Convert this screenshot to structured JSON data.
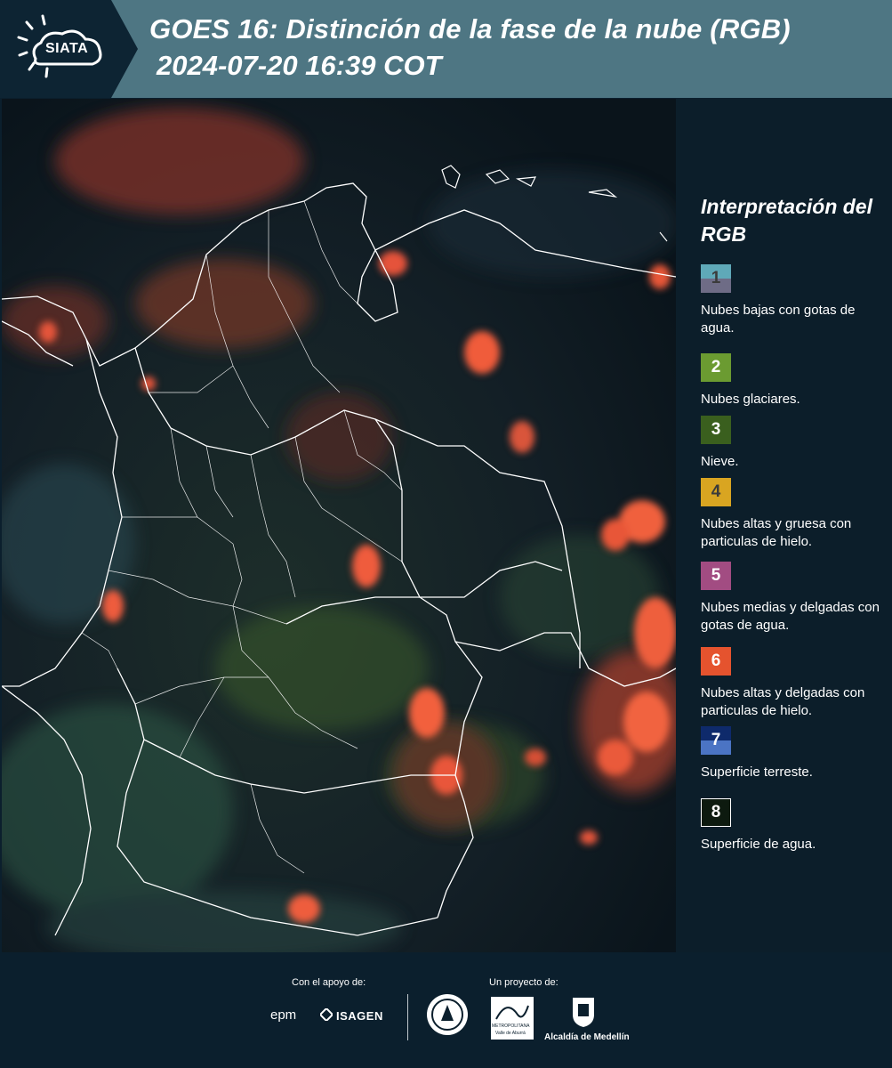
{
  "header": {
    "title": "GOES 16: Distinción de la fase de la nube (RGB)",
    "datetime": "2024-07-20 16:39 COT",
    "logo_text": "SIATA"
  },
  "legend": {
    "title": "Interpretación del RGB",
    "items": [
      {
        "num": "1",
        "color_top": "#5fa9b8",
        "color_bottom": "#6e6c86",
        "text_color": "#3b3b3b",
        "label": "Nubes bajas con gotas de agua."
      },
      {
        "num": "2",
        "color": "#6b9b31",
        "text_color": "#ffffff",
        "label": "Nubes glaciares."
      },
      {
        "num": "3",
        "color": "#3a5f1e",
        "text_color": "#ffffff",
        "label": "Nieve."
      },
      {
        "num": "4",
        "color": "#d9a521",
        "text_color": "#3b3b3b",
        "label": "Nubes altas y gruesa con particulas de hielo."
      },
      {
        "num": "5",
        "color": "#a24c82",
        "text_color": "#ffffff",
        "label": "Nubes medias y delgadas con gotas de agua."
      },
      {
        "num": "6",
        "color": "#e5532e",
        "text_color": "#ffffff",
        "label": "Nubes altas y delgadas con particulas de hielo."
      },
      {
        "num": "7",
        "color_top": "#0e2a6b",
        "color_bottom": "#4b74c4",
        "text_color": "#ffffff",
        "label": "Superficie terreste."
      },
      {
        "num": "8",
        "color": "#0d1a0f",
        "text_color": "#ffffff",
        "border": "#ffffff",
        "label": "Superficie de agua."
      }
    ]
  },
  "footer": {
    "support_label": "Con el apoyo de:",
    "project_label": "Un proyecto de:",
    "epm": "epm",
    "isagen": "ISAGEN",
    "metropolitana": "METROPOLITANA",
    "valle": "Valle de Aburrá",
    "alcaldia": "Alcaldía de Medellín"
  }
}
